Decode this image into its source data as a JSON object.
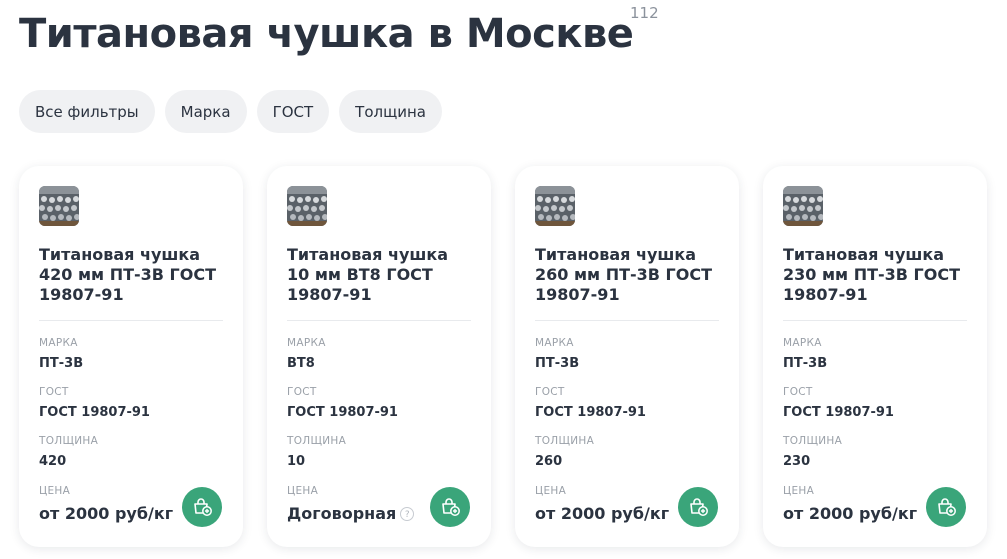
{
  "header": {
    "title": "Титановая чушка в Москве",
    "count": "112"
  },
  "filters": [
    {
      "label": "Все фильтры"
    },
    {
      "label": "Марка"
    },
    {
      "label": "ГОСТ"
    },
    {
      "label": "Толщина"
    }
  ],
  "spec_labels": {
    "grade": "МАРКА",
    "gost": "ГОСТ",
    "thickness": "ТОЛЩИНА",
    "price": "ЦЕНА"
  },
  "cards": [
    {
      "name": "Титановая чушка 420 мм ПТ-3В ГОСТ 19807-91",
      "grade": "ПТ-3В",
      "gost": "ГОСТ 19807-91",
      "thickness": "420",
      "price": "от 2000 руб/кг"
    },
    {
      "name": "Титановая чушка 10 мм ВТ8 ГОСТ 19807-91",
      "grade": "ВТ8",
      "gost": "ГОСТ 19807-91",
      "thickness": "10",
      "price": "Договорная"
    },
    {
      "name": "Титановая чушка 260 мм ПТ-3В ГОСТ 19807-91",
      "grade": "ПТ-3В",
      "gost": "ГОСТ 19807-91",
      "thickness": "260",
      "price": "от 2000 руб/кг"
    },
    {
      "name": "Титановая чушка 230 мм ПТ-3В ГОСТ 19807-91",
      "grade": "ПТ-3В",
      "gost": "ГОСТ 19807-91",
      "thickness": "230",
      "price": "от 2000 руб/кг"
    }
  ],
  "colors": {
    "accent": "#3aa57a",
    "text": "#2b3340",
    "muted": "#9aa0a8",
    "chip_bg": "#f0f1f3"
  }
}
